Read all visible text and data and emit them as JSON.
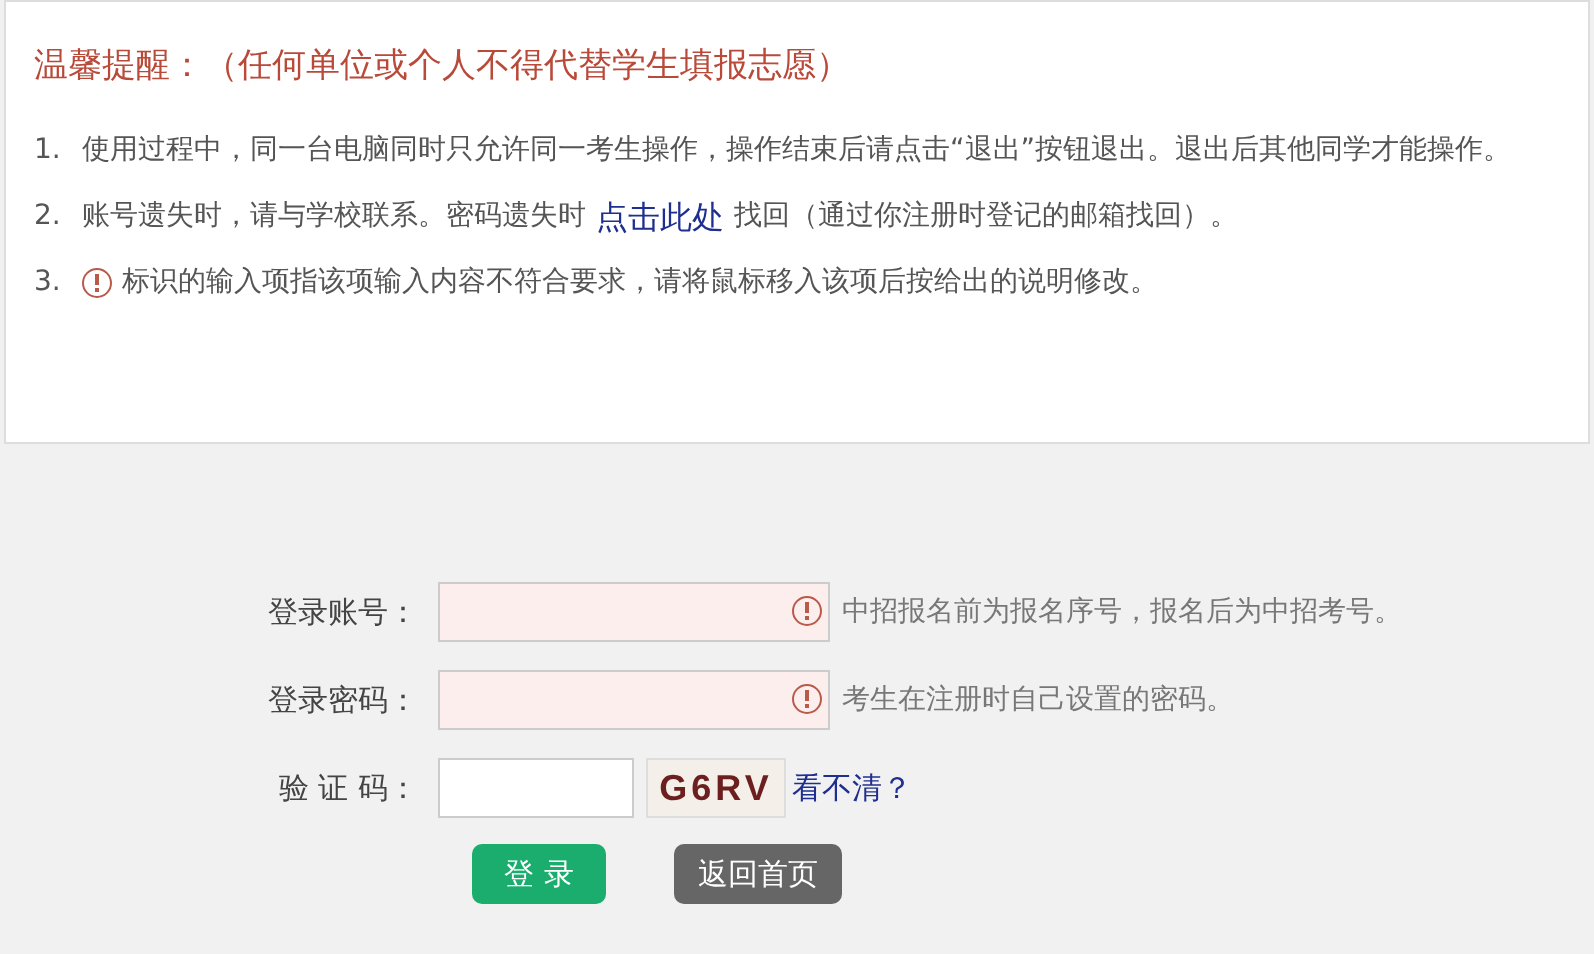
{
  "notice": {
    "title": "温馨提醒：（任何单位或个人不得代替学生填报志愿）",
    "items": [
      {
        "number": "1.",
        "parts": [
          {
            "kind": "text",
            "text": "使用过程中，同一台电脑同时只允许同一考生操作，操作结束后请点击“退出”按钮退出。退出后其他同学才能操作。"
          }
        ]
      },
      {
        "number": "2.",
        "parts": [
          {
            "kind": "text",
            "text": "账号遗失时，请与学校联系。密码遗失时"
          },
          {
            "kind": "link",
            "text": "点击此处"
          },
          {
            "kind": "text",
            "text": "找回（通过你注册时登记的邮箱找回）。"
          }
        ]
      },
      {
        "number": "3.",
        "parts": [
          {
            "kind": "icon"
          },
          {
            "kind": "text",
            "text": "标识的输入项指该项输入内容不符合要求，请将鼠标移入该项后按给出的说明修改。"
          }
        ]
      }
    ]
  },
  "form": {
    "fields": [
      {
        "kind": "text",
        "label": "登录账号：",
        "invalid": true,
        "hint": "中招报名前为报名序号，报名后为中招考号。"
      },
      {
        "kind": "password",
        "label": "登录密码：",
        "invalid": true,
        "hint": "考生在注册时自己设置的密码。"
      },
      {
        "kind": "captcha",
        "label": "验 证 码：",
        "invalid": false,
        "captcha": "G6RV",
        "refresh_link": "看不清？"
      }
    ],
    "buttons": [
      {
        "kind": "primary",
        "label": "登 录"
      },
      {
        "kind": "secondary",
        "label": "返回首页"
      }
    ]
  }
}
